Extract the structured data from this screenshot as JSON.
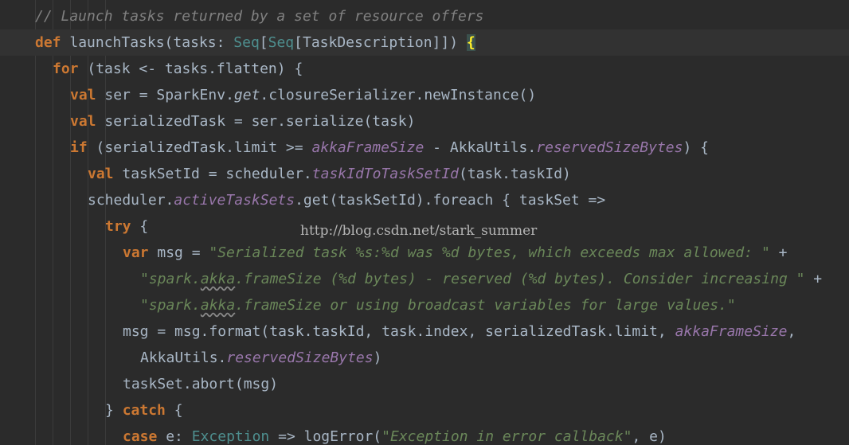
{
  "editor": {
    "watermark": "http://blog.csdn.net/stark_summer",
    "current_line_index": 1,
    "colors": {
      "background": "#2b2b2b",
      "keyword": "#cc7832",
      "comment": "#808080",
      "string": "#6a8759",
      "type": "#4e8f8f",
      "field": "#9876aa",
      "plain": "#a9b7c6"
    },
    "lines": [
      {
        "indent": 0,
        "tokens": [
          {
            "t": "// Launch tasks returned by a set of resource offers",
            "c": "cm"
          }
        ]
      },
      {
        "indent": 0,
        "tokens": [
          {
            "t": "def",
            "c": "kw"
          },
          {
            "t": " launchTasks(tasks: ",
            "c": "sp"
          },
          {
            "t": "Seq",
            "c": "ty"
          },
          {
            "t": "[",
            "c": "sp"
          },
          {
            "t": "Seq",
            "c": "ty"
          },
          {
            "t": "[TaskDescription]]) ",
            "c": "sp"
          },
          {
            "t": "{",
            "c": "brace-hl"
          }
        ]
      },
      {
        "indent": 1,
        "tokens": [
          {
            "t": "for",
            "c": "kw"
          },
          {
            "t": " (task <- tasks.flatten) {",
            "c": "sp"
          }
        ]
      },
      {
        "indent": 2,
        "tokens": [
          {
            "t": "val",
            "c": "kw"
          },
          {
            "t": " ser = SparkEnv.",
            "c": "sp"
          },
          {
            "t": "get",
            "c": "it"
          },
          {
            "t": ".closureSerializer.newInstance()",
            "c": "sp"
          }
        ]
      },
      {
        "indent": 2,
        "tokens": [
          {
            "t": "val",
            "c": "kw"
          },
          {
            "t": " serializedTask = ser.serialize(task)",
            "c": "sp"
          }
        ]
      },
      {
        "indent": 2,
        "tokens": [
          {
            "t": "if",
            "c": "kw"
          },
          {
            "t": " (serializedTask.limit >= ",
            "c": "sp"
          },
          {
            "t": "akkaFrameSize",
            "c": "fld"
          },
          {
            "t": " - AkkaUtils.",
            "c": "sp"
          },
          {
            "t": "reservedSizeBytes",
            "c": "fld"
          },
          {
            "t": ") {",
            "c": "sp"
          }
        ]
      },
      {
        "indent": 3,
        "tokens": [
          {
            "t": "val",
            "c": "kw"
          },
          {
            "t": " taskSetId = scheduler.",
            "c": "sp"
          },
          {
            "t": "taskIdToTaskSetId",
            "c": "fld"
          },
          {
            "t": "(task.taskId)",
            "c": "sp"
          }
        ]
      },
      {
        "indent": 3,
        "tokens": [
          {
            "t": "scheduler.",
            "c": "sp"
          },
          {
            "t": "activeTaskSets",
            "c": "fld"
          },
          {
            "t": ".get(taskSetId).foreach { taskSet =>",
            "c": "sp"
          }
        ]
      },
      {
        "indent": 4,
        "tokens": [
          {
            "t": "try",
            "c": "kw"
          },
          {
            "t": " {",
            "c": "sp"
          }
        ]
      },
      {
        "indent": 5,
        "tokens": [
          {
            "t": "var",
            "c": "kw"
          },
          {
            "t": " msg = ",
            "c": "sp"
          },
          {
            "t": "\"Serialized task %s:%d was %d bytes, which exceeds max allowed: \"",
            "c": "str"
          },
          {
            "t": " +",
            "c": "sp"
          }
        ]
      },
      {
        "indent": 6,
        "tokens": [
          {
            "t": "\"spark.",
            "c": "str"
          },
          {
            "t": "akka",
            "c": "str squig"
          },
          {
            "t": ".frameSize (%d bytes) - reserved (%d bytes). Consider increasing \"",
            "c": "str"
          },
          {
            "t": " +",
            "c": "sp"
          }
        ]
      },
      {
        "indent": 6,
        "tokens": [
          {
            "t": "\"spark.",
            "c": "str"
          },
          {
            "t": "akka",
            "c": "str squig"
          },
          {
            "t": ".frameSize or using broadcast variables for large values.\"",
            "c": "str"
          }
        ]
      },
      {
        "indent": 5,
        "tokens": [
          {
            "t": "msg = msg.format(task.taskId, task.index, serializedTask.limit, ",
            "c": "sp"
          },
          {
            "t": "akkaFrameSize",
            "c": "fld"
          },
          {
            "t": ",",
            "c": "sp"
          }
        ]
      },
      {
        "indent": 6,
        "tokens": [
          {
            "t": "AkkaUtils.",
            "c": "sp"
          },
          {
            "t": "reservedSizeBytes",
            "c": "fld"
          },
          {
            "t": ")",
            "c": "sp"
          }
        ]
      },
      {
        "indent": 5,
        "tokens": [
          {
            "t": "taskSet.abort(msg)",
            "c": "sp"
          }
        ]
      },
      {
        "indent": 4,
        "tokens": [
          {
            "t": "} ",
            "c": "sp"
          },
          {
            "t": "catch",
            "c": "kw"
          },
          {
            "t": " {",
            "c": "sp"
          }
        ]
      },
      {
        "indent": 5,
        "tokens": [
          {
            "t": "case",
            "c": "kw"
          },
          {
            "t": " e: ",
            "c": "sp"
          },
          {
            "t": "Exception",
            "c": "ty"
          },
          {
            "t": " => logError(",
            "c": "sp"
          },
          {
            "t": "\"Exception in error callback\"",
            "c": "str"
          },
          {
            "t": ", e)",
            "c": "sp"
          }
        ]
      }
    ]
  }
}
